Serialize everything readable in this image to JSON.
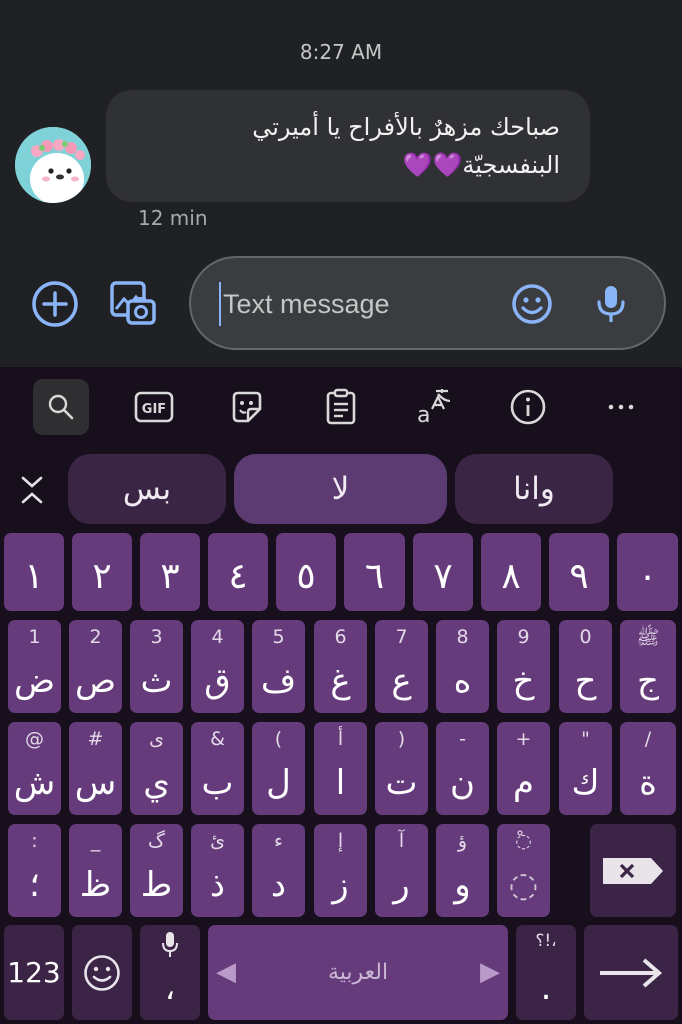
{
  "chat": {
    "timestamp": "8:27 AM",
    "message_line1": "صباحك مزهرٌ بالأفراح يا أميرتي",
    "message_line2": "البنفسجيّة💜💜",
    "message_time": "12 min"
  },
  "compose": {
    "placeholder": "Text message",
    "icons": [
      "add-icon",
      "gallery-icon",
      "emoji-icon",
      "mic-icon"
    ]
  },
  "toolbar": {
    "icons": [
      "search-icon",
      "gif-icon",
      "sticker-icon",
      "clipboard-icon",
      "translate-icon",
      "info-icon",
      "more-icon"
    ],
    "gif_label": "GIF",
    "more_label": "⋯"
  },
  "suggestions": [
    "بس",
    "لا",
    "وانا"
  ],
  "keys": {
    "numbers": [
      "١",
      "٢",
      "٣",
      "٤",
      "٥",
      "٦",
      "٧",
      "٨",
      "٩",
      "٠"
    ],
    "row1": [
      {
        "main": "ض",
        "hint": "1"
      },
      {
        "main": "ص",
        "hint": "2"
      },
      {
        "main": "ث",
        "hint": "3"
      },
      {
        "main": "ق",
        "hint": "4"
      },
      {
        "main": "ف",
        "hint": "5"
      },
      {
        "main": "غ",
        "hint": "6"
      },
      {
        "main": "ع",
        "hint": "7"
      },
      {
        "main": "ه",
        "hint": "8"
      },
      {
        "main": "خ",
        "hint": "9"
      },
      {
        "main": "ح",
        "hint": "0"
      },
      {
        "main": "ج",
        "hint": "ﷺ"
      }
    ],
    "row2": [
      {
        "main": "ش",
        "hint": "@"
      },
      {
        "main": "س",
        "hint": "#"
      },
      {
        "main": "ي",
        "hint": "ى"
      },
      {
        "main": "ب",
        "hint": "&"
      },
      {
        "main": "ل",
        "hint": "("
      },
      {
        "main": "ا",
        "hint": "أ"
      },
      {
        "main": "ت",
        "hint": ")"
      },
      {
        "main": "ن",
        "hint": "-"
      },
      {
        "main": "م",
        "hint": "+"
      },
      {
        "main": "ك",
        "hint": "\""
      },
      {
        "main": "ة",
        "hint": "/"
      }
    ],
    "row3": [
      {
        "main": "؛",
        "hint": ":"
      },
      {
        "main": "ظ",
        "hint": "_"
      },
      {
        "main": "ط",
        "hint": "گ"
      },
      {
        "main": "ذ",
        "hint": "ئ"
      },
      {
        "main": "د",
        "hint": "ء"
      },
      {
        "main": "ز",
        "hint": "إ"
      },
      {
        "main": "ر",
        "hint": "آ"
      },
      {
        "main": "و",
        "hint": "ؤ"
      },
      {
        "main": "◌",
        "hint": "◌ْ"
      }
    ],
    "bottom": {
      "symbols": "123",
      "comma_main": "،",
      "space_label": "العربية",
      "period_hint": "؟!،",
      "period_main": "."
    }
  },
  "colors": {
    "key": "#653b7b",
    "keyboard_bg": "#170f1c",
    "accent": "#8ab4f8",
    "suggestion_active": "#5c3b72"
  }
}
